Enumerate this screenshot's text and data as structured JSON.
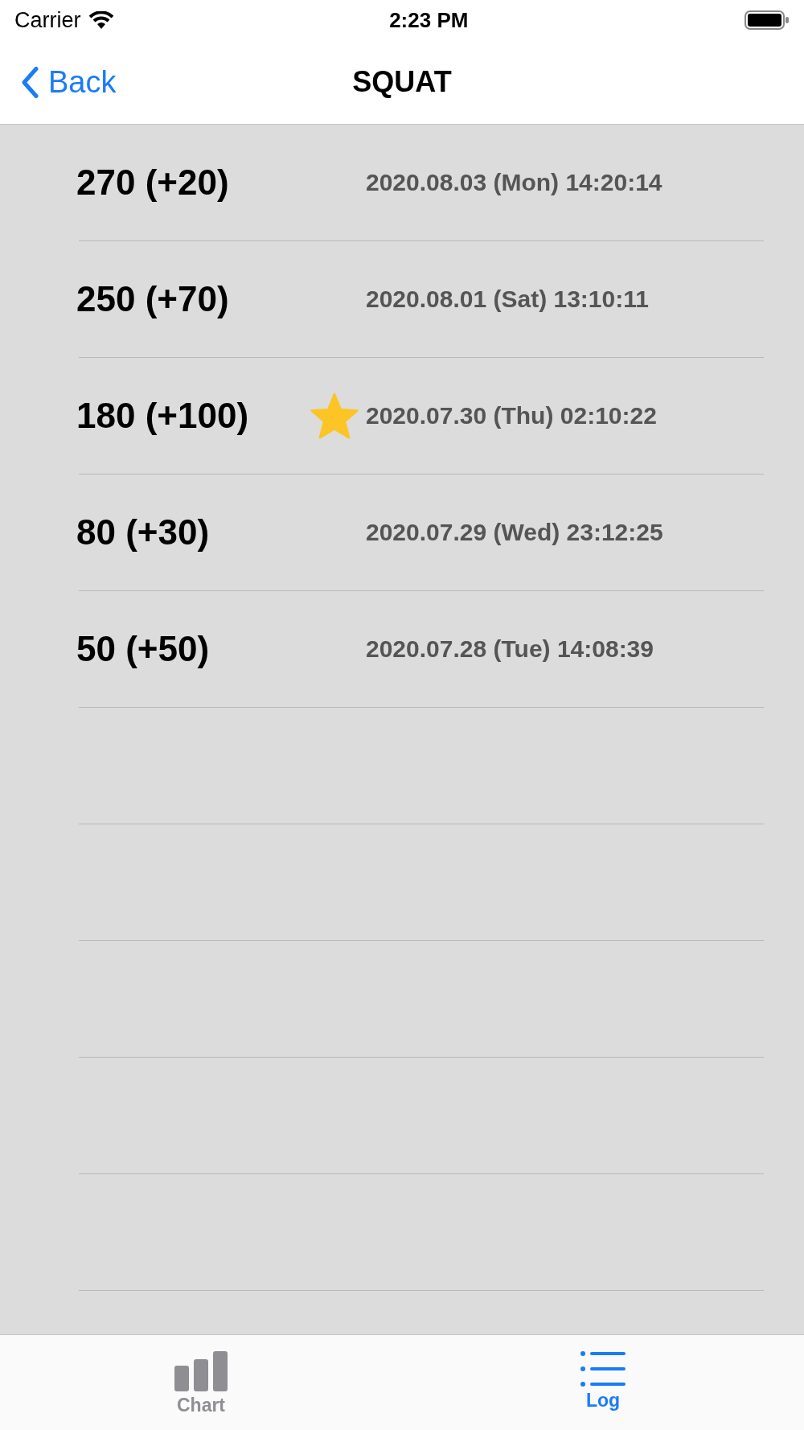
{
  "status_bar": {
    "carrier": "Carrier",
    "time": "2:23 PM"
  },
  "nav": {
    "back": "Back",
    "title": "SQUAT"
  },
  "log": [
    {
      "weight": "270 (+20)",
      "starred": false,
      "date": "2020.08.03 (Mon) 14:20:14"
    },
    {
      "weight": "250 (+70)",
      "starred": false,
      "date": "2020.08.01 (Sat) 13:10:11"
    },
    {
      "weight": "180 (+100)",
      "starred": true,
      "date": "2020.07.30 (Thu) 02:10:22"
    },
    {
      "weight": "80 (+30)",
      "starred": false,
      "date": "2020.07.29 (Wed) 23:12:25"
    },
    {
      "weight": "50 (+50)",
      "starred": false,
      "date": "2020.07.28 (Tue) 14:08:39"
    }
  ],
  "tabs": [
    {
      "label": "Chart",
      "kind": "chart",
      "selected": false
    },
    {
      "label": "Log",
      "kind": "list",
      "selected": true
    }
  ]
}
